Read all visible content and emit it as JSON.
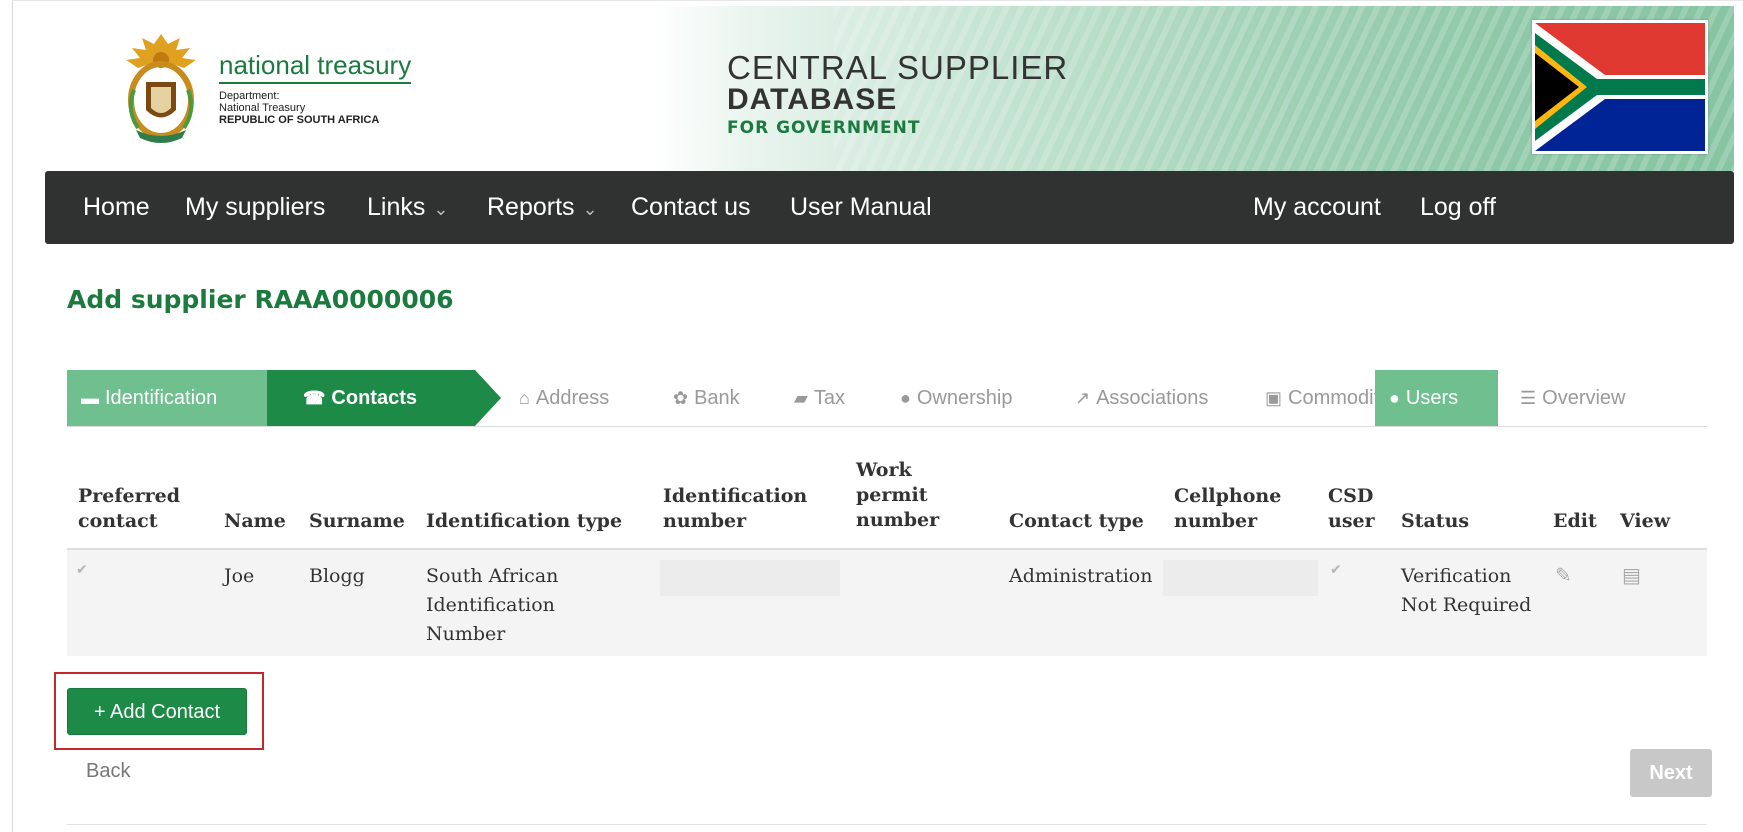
{
  "header": {
    "org_name": "national treasury",
    "org_sub_1": "Department:",
    "org_sub_2": "National Treasury",
    "org_sub_3": "REPUBLIC OF SOUTH AFRICA",
    "title_line1": "CENTRAL SUPPLIER",
    "title_line2": "DATABASE",
    "title_line3": "FOR GOVERNMENT"
  },
  "nav": {
    "home": "Home",
    "my_suppliers": "My suppliers",
    "links": "Links",
    "reports": "Reports",
    "contact_us": "Contact us",
    "user_manual": "User Manual",
    "my_account": "My account",
    "log_off": "Log off"
  },
  "page_title": "Add supplier RAAA0000006",
  "wizard": {
    "identification": "Identification",
    "contacts": "Contacts",
    "address": "Address",
    "bank": "Bank",
    "tax": "Tax",
    "ownership": "Ownership",
    "associations": "Associations",
    "commodities": "Commodities",
    "users": "Users",
    "overview": "Overview"
  },
  "table": {
    "headers": {
      "preferred_1": "Preferred",
      "preferred_2": "contact",
      "name": "Name",
      "surname": "Surname",
      "id_type": "Identification type",
      "id_number_1": "Identification",
      "id_number_2": "number",
      "work_1": "Work",
      "work_2": "permit",
      "work_3": "number",
      "contact_type": "Contact type",
      "cell_1": "Cellphone",
      "cell_2": "number",
      "csd_1": "CSD",
      "csd_2": "user",
      "status": "Status",
      "edit": "Edit",
      "view": "View"
    },
    "rows": [
      {
        "name": "Joe",
        "surname": "Blogg",
        "id_type_1": "South African",
        "id_type_2": "Identification",
        "id_type_3": "Number",
        "contact_type": "Administration",
        "status_1": "Verification",
        "status_2": "Not Required"
      }
    ]
  },
  "actions": {
    "add_contact": "+ Add Contact",
    "back": "Back",
    "next": "Next"
  },
  "icons": {
    "check": "✔",
    "edit": "✎",
    "view": "▤",
    "caret": "⌄"
  },
  "colors": {
    "brand_green": "#1d8a48",
    "light_green": "#6fbf8f",
    "navbar": "#2f3230",
    "highlight_red": "#c1272d"
  }
}
